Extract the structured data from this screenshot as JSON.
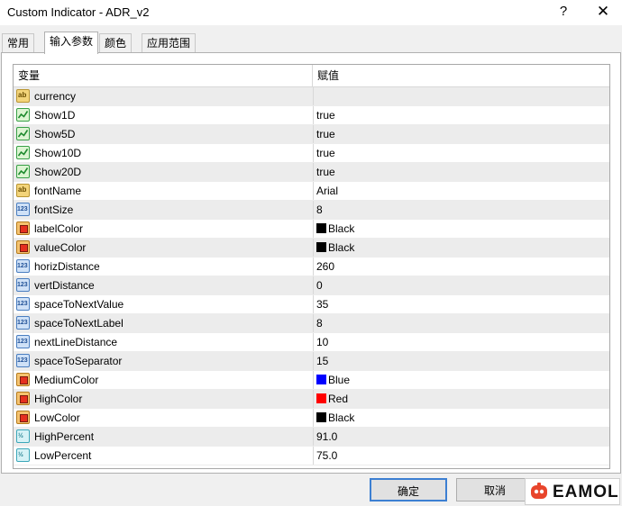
{
  "window": {
    "title": "Custom Indicator - ADR_v2",
    "help_label": "?",
    "close_label": "✕"
  },
  "tabs": [
    {
      "label": "常用"
    },
    {
      "label": "输入参数"
    },
    {
      "label": "颜色"
    },
    {
      "label": "应用范围"
    }
  ],
  "grid": {
    "col_variable": "变量",
    "col_value": "赋值"
  },
  "params": [
    {
      "name": "currency",
      "value": "",
      "icon": "string-type-icon"
    },
    {
      "name": "Show1D",
      "value": "true",
      "icon": "bool-type-icon"
    },
    {
      "name": "Show5D",
      "value": "true",
      "icon": "bool-type-icon"
    },
    {
      "name": "Show10D",
      "value": "true",
      "icon": "bool-type-icon"
    },
    {
      "name": "Show20D",
      "value": "true",
      "icon": "bool-type-icon"
    },
    {
      "name": "fontName",
      "value": "Arial",
      "icon": "string-type-icon"
    },
    {
      "name": "fontSize",
      "value": "8",
      "icon": "int-type-icon"
    },
    {
      "name": "labelColor",
      "value": "Black",
      "icon": "color-type-icon",
      "swatch": "#000000"
    },
    {
      "name": "valueColor",
      "value": "Black",
      "icon": "color-type-icon",
      "swatch": "#000000"
    },
    {
      "name": "horizDistance",
      "value": "260",
      "icon": "int-type-icon"
    },
    {
      "name": "vertDistance",
      "value": "0",
      "icon": "int-type-icon"
    },
    {
      "name": "spaceToNextValue",
      "value": "35",
      "icon": "int-type-icon"
    },
    {
      "name": "spaceToNextLabel",
      "value": "8",
      "icon": "int-type-icon"
    },
    {
      "name": "nextLineDistance",
      "value": "10",
      "icon": "int-type-icon"
    },
    {
      "name": "spaceToSeparator",
      "value": "15",
      "icon": "int-type-icon"
    },
    {
      "name": "MediumColor",
      "value": "Blue",
      "icon": "color-type-icon",
      "swatch": "#0000ff"
    },
    {
      "name": "HighColor",
      "value": "Red",
      "icon": "color-type-icon",
      "swatch": "#ff0000"
    },
    {
      "name": "LowColor",
      "value": "Black",
      "icon": "color-type-icon",
      "swatch": "#000000"
    },
    {
      "name": "HighPercent",
      "value": "91.0",
      "icon": "double-type-icon"
    },
    {
      "name": "LowPercent",
      "value": "75.0",
      "icon": "double-type-icon"
    }
  ],
  "buttons": {
    "ok": "确定",
    "cancel": "取消"
  },
  "watermark": {
    "text": "EAMOL"
  }
}
